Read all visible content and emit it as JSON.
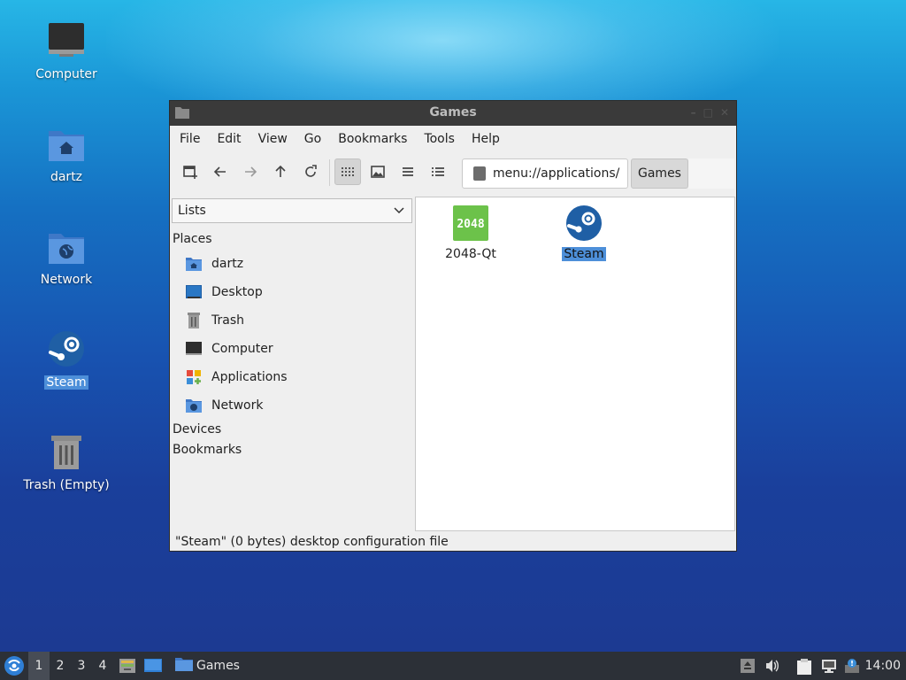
{
  "desktop": {
    "icons": [
      {
        "label": "Computer",
        "icon": "monitor-icon"
      },
      {
        "label": "dartz",
        "icon": "home-folder-icon"
      },
      {
        "label": "Network",
        "icon": "network-folder-icon"
      },
      {
        "label": "Steam",
        "icon": "steam-icon",
        "selected": true
      },
      {
        "label": "Trash (Empty)",
        "icon": "trash-icon"
      }
    ]
  },
  "window": {
    "title": "Games",
    "menu": [
      "File",
      "Edit",
      "View",
      "Go",
      "Bookmarks",
      "Tools",
      "Help"
    ],
    "path": "menu://applications/",
    "path_button": "Games",
    "side_mode": "Lists",
    "sections": {
      "places": "Places",
      "devices": "Devices",
      "bookmarks": "Bookmarks"
    },
    "places": [
      {
        "label": "dartz",
        "icon": "home-folder-icon"
      },
      {
        "label": "Desktop",
        "icon": "desktop-icon"
      },
      {
        "label": "Trash",
        "icon": "trash-icon"
      },
      {
        "label": "Computer",
        "icon": "monitor-icon"
      },
      {
        "label": "Applications",
        "icon": "applications-icon"
      },
      {
        "label": "Network",
        "icon": "network-folder-icon"
      }
    ],
    "apps": [
      {
        "label": "2048-Qt",
        "icon_text": "2048",
        "color": "#6cc24a"
      },
      {
        "label": "Steam",
        "selected": true
      }
    ],
    "status": "\"Steam\" (0 bytes) desktop configuration file"
  },
  "taskbar": {
    "workspaces": [
      "1",
      "2",
      "3",
      "4"
    ],
    "active_workspace": "1",
    "task": "Games",
    "clock": "14:00"
  },
  "colors": {
    "selection": "#4d8fd9",
    "titlebar": "#3a3a3a",
    "taskbar": "#2c3037",
    "folder": "#4a86d4"
  }
}
